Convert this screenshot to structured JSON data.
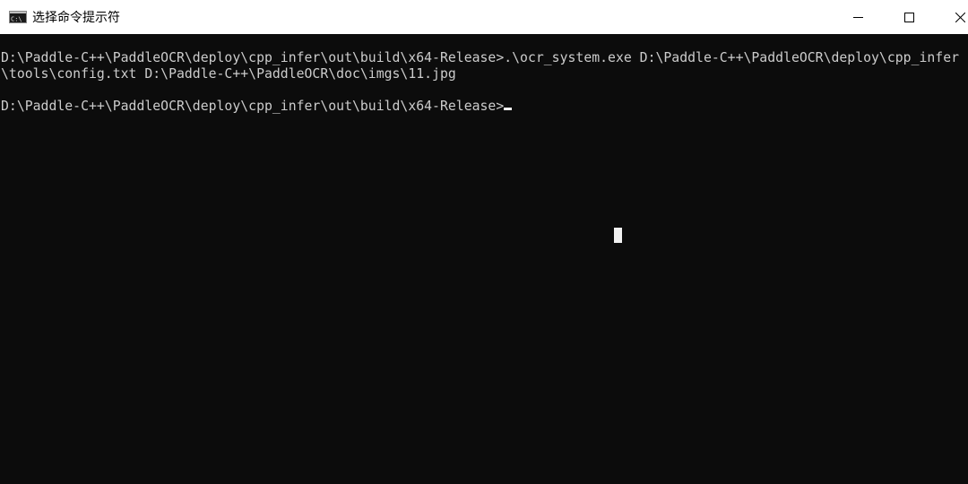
{
  "window": {
    "title": "选择命令提示符",
    "app_icon": "cmd-icon",
    "controls": [
      "minimize-icon",
      "maximize-icon",
      "close-icon"
    ]
  },
  "console": {
    "lines": [
      "D:\\Paddle-C++\\PaddleOCR\\deploy\\cpp_infer\\out\\build\\x64-Release>.\\ocr_system.exe D:\\Paddle-C++\\PaddleOCR\\deploy\\cpp_infer",
      "\\tools\\config.txt D:\\Paddle-C++\\PaddleOCR\\doc\\imgs\\11.jpg",
      "",
      "D:\\Paddle-C++\\PaddleOCR\\deploy\\cpp_infer\\out\\build\\x64-Release>"
    ]
  },
  "colors": {
    "background": "#0c0c0c",
    "text": "#cccccc",
    "titlebar": "#ffffff"
  }
}
